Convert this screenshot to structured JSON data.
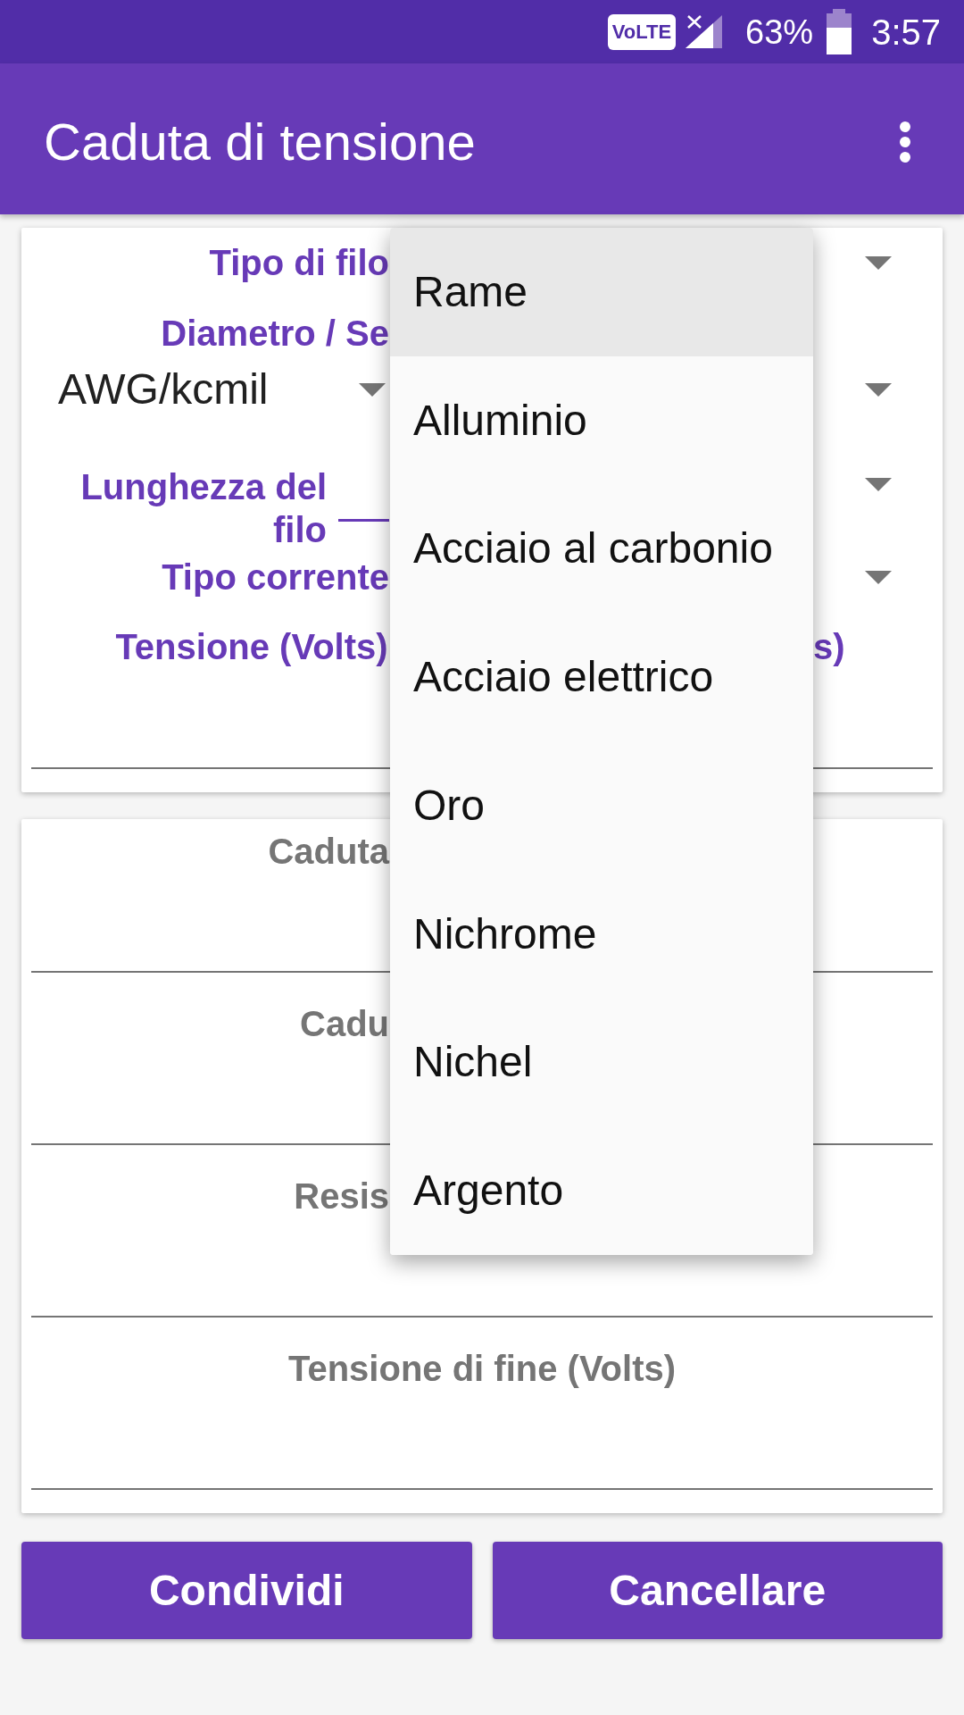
{
  "status_bar": {
    "network": "VoLTE",
    "battery": "63%",
    "time": "3:57"
  },
  "app_bar": {
    "title": "Caduta di tensione"
  },
  "wire_form": {
    "wire_type": {
      "label": "Tipo di filo"
    },
    "diameter": {
      "label": "Diametro / Se",
      "unit": "AWG/kcmil"
    },
    "length": {
      "label": "Lunghezza del filo",
      "focused": true
    },
    "current_type": {
      "label": "Tipo corrente"
    },
    "inputs": [
      {
        "label": "Tensione (Volts)",
        "covered": false
      },
      {
        "label": "s)",
        "covered": true
      }
    ]
  },
  "results": {
    "fields": [
      {
        "label": "Caduta",
        "covered": true
      },
      {
        "label": "Cadu",
        "covered": true
      },
      {
        "label": "Resis",
        "covered": true
      },
      {
        "label": "Tensione di fine (Volts)",
        "covered": false
      }
    ]
  },
  "dropdown": {
    "options": [
      {
        "label": "Rame",
        "selected": true
      },
      {
        "label": "Alluminio",
        "selected": false
      },
      {
        "label": "Acciaio al carbonio",
        "selected": false
      },
      {
        "label": "Acciaio elettrico",
        "selected": false
      },
      {
        "label": "Oro",
        "selected": false
      },
      {
        "label": "Nichrome",
        "selected": false
      },
      {
        "label": "Nichel",
        "selected": false
      },
      {
        "label": "Argento",
        "selected": false
      }
    ]
  },
  "buttons": [
    "Condividi",
    "Cancellare"
  ]
}
